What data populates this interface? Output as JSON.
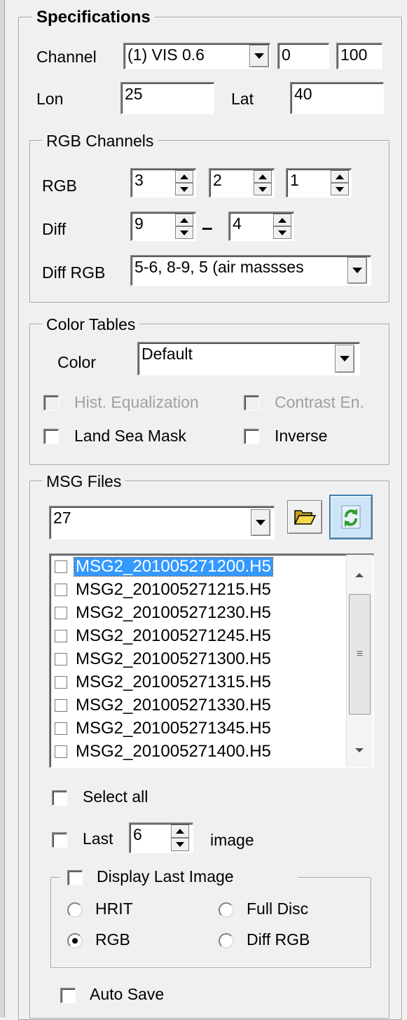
{
  "specifications": {
    "title": "Specifications",
    "channel_label": "Channel",
    "channel_value": "(1) VIS 0.6",
    "range_min": "0",
    "range_max": "100",
    "lon_label": "Lon",
    "lon_value": "25",
    "lat_label": "Lat",
    "lat_value": "40"
  },
  "rgb_channels": {
    "title": "RGB Channels",
    "rgb_label": "RGB",
    "rgb_values": [
      "3",
      "2",
      "1"
    ],
    "diff_label": "Diff",
    "diff_a": "9",
    "diff_sep": "–",
    "diff_b": "4",
    "diff_rgb_label": "Diff RGB",
    "diff_rgb_value": "5-6, 8-9, 5  (air massses"
  },
  "color_tables": {
    "title": "Color Tables",
    "color_label": "Color",
    "color_value": "Default",
    "hist_eq": "Hist. Equalization",
    "contrast": "Contrast En.",
    "land_sea": "Land Sea Mask",
    "inverse": "Inverse"
  },
  "msg_files": {
    "title": "MSG Files",
    "day_value": "27",
    "files": [
      "MSG2_201005271200.H5",
      "MSG2_201005271215.H5",
      "MSG2_201005271230.H5",
      "MSG2_201005271245.H5",
      "MSG2_201005271300.H5",
      "MSG2_201005271315.H5",
      "MSG2_201005271330.H5",
      "MSG2_201005271345.H5",
      "MSG2_201005271400.H5"
    ],
    "selected_index": 0,
    "select_all": "Select all",
    "last_label": "Last",
    "last_value": "6",
    "image_label": "image"
  },
  "display_last": {
    "title": "Display Last Image",
    "hrit": "HRIT",
    "full_disc": "Full Disc",
    "rgb": "RGB",
    "diff_rgb": "Diff RGB",
    "selected": "RGB"
  },
  "auto_save": "Auto Save",
  "icons": {
    "open": "folder-open-icon",
    "refresh": "refresh-icon"
  },
  "colors": {
    "selection": "#3399ff",
    "folder": "#f6d64a",
    "refresh": "#2e9e2e"
  }
}
